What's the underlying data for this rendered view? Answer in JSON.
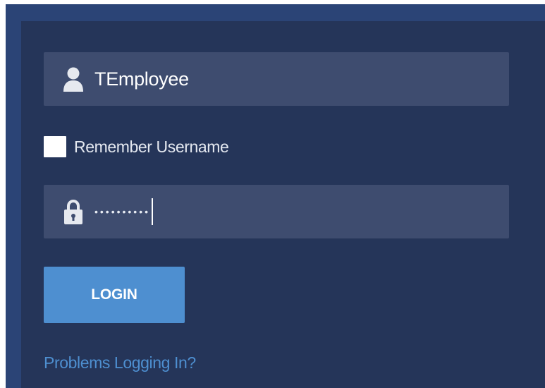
{
  "login_form": {
    "username_field": {
      "value": "TEmployee",
      "icon": "user-icon"
    },
    "remember_username": {
      "label": "Remember Username",
      "checked": false
    },
    "password_field": {
      "masked_value": "••••••••••",
      "icon": "lock-icon"
    },
    "login_button_label": "LOGIN",
    "problems_link_label": "Problems Logging In?"
  },
  "colors": {
    "outer_frame": "#2b4476",
    "panel_background": "#253559",
    "field_background": "#3e4c6f",
    "accent": "#4e8fd0",
    "text": "#ffffff"
  }
}
